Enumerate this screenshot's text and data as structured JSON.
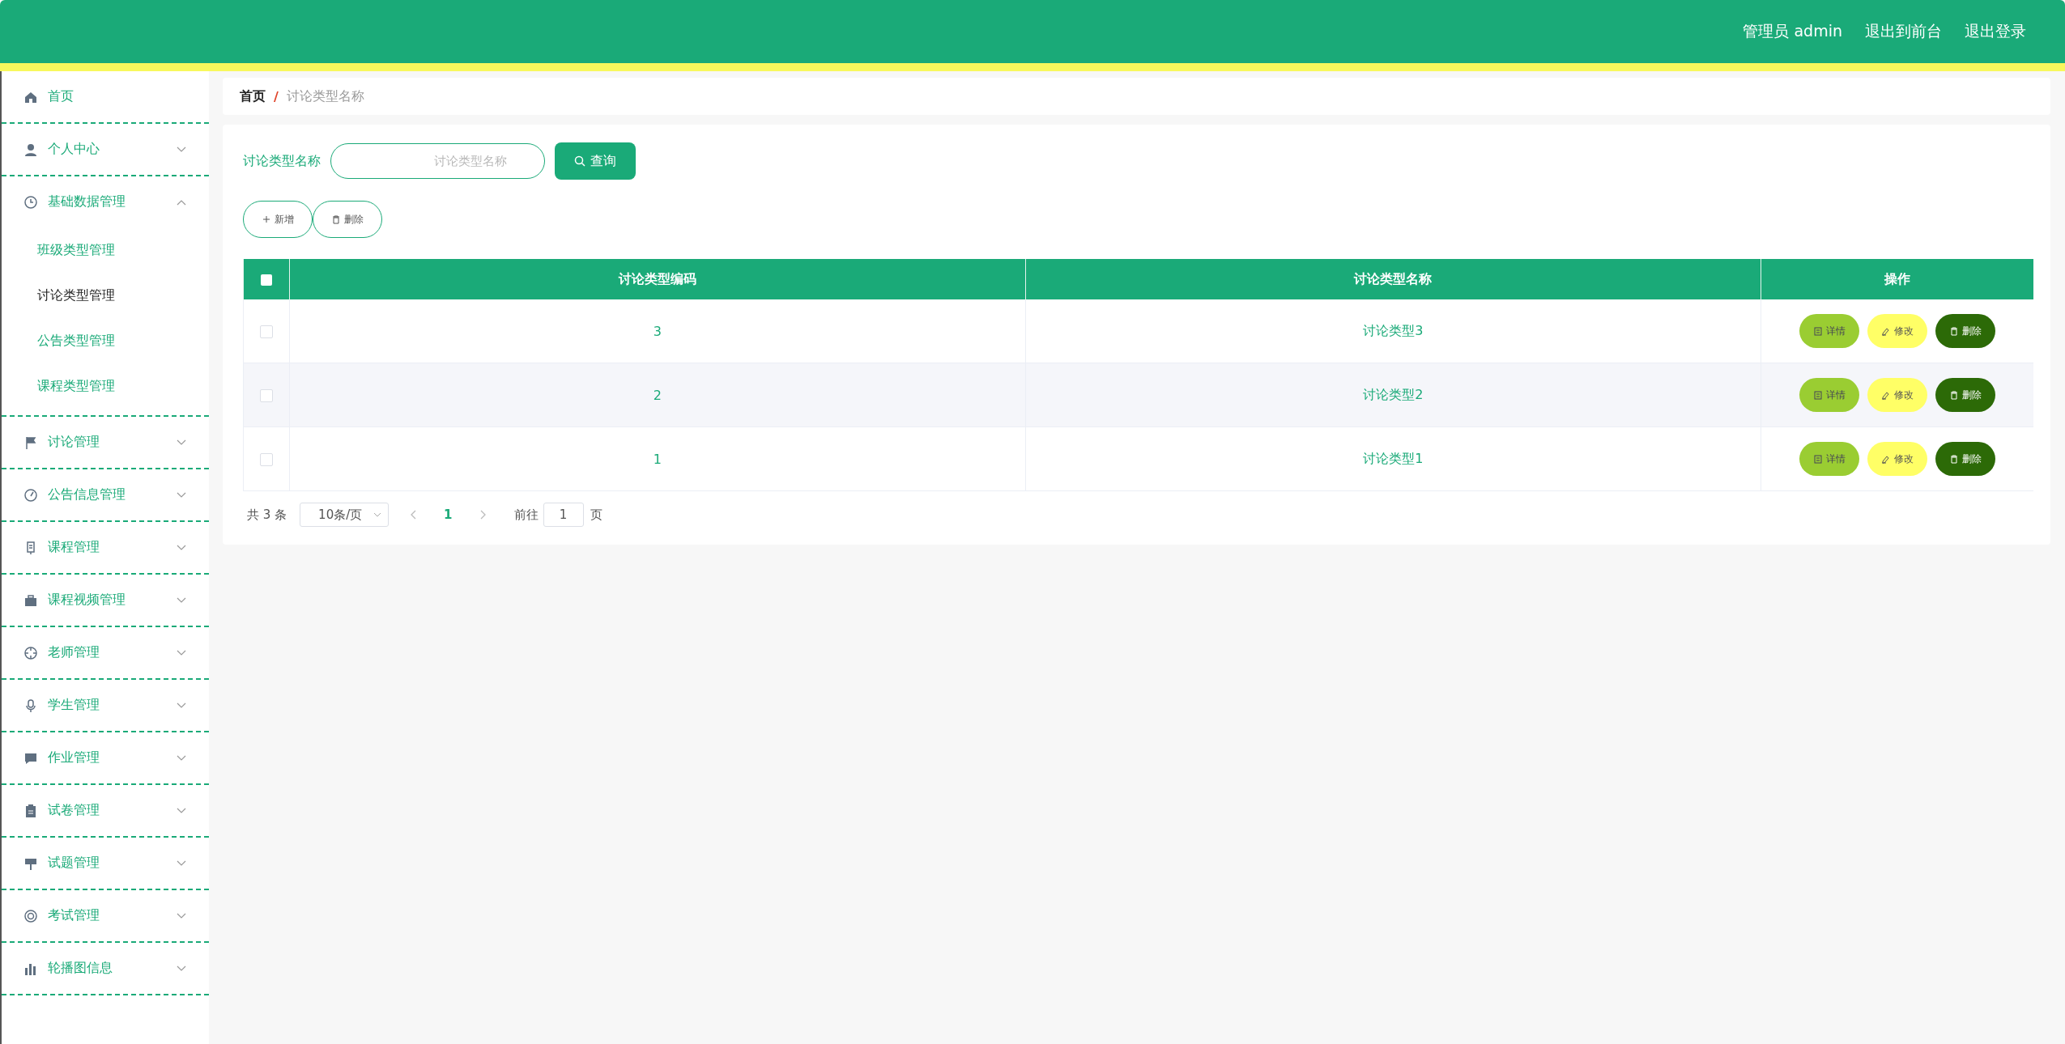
{
  "header": {
    "user_label": "管理员 admin",
    "links": [
      "退出到前台",
      "退出登录"
    ]
  },
  "sidebar": {
    "items": [
      {
        "label": "首页"
      },
      {
        "label": "个人中心",
        "expanded": false
      },
      {
        "label": "基础数据管理",
        "expanded": true,
        "children": [
          {
            "label": "班级类型管理",
            "selected": false
          },
          {
            "label": "讨论类型管理",
            "selected": true
          },
          {
            "label": "公告类型管理",
            "selected": false
          },
          {
            "label": "课程类型管理",
            "selected": false
          }
        ]
      },
      {
        "label": "讨论管理",
        "expanded": false
      },
      {
        "label": "公告信息管理",
        "expanded": false
      },
      {
        "label": "课程管理",
        "expanded": false
      },
      {
        "label": "课程视频管理",
        "expanded": false
      },
      {
        "label": "老师管理",
        "expanded": false
      },
      {
        "label": "学生管理",
        "expanded": false
      },
      {
        "label": "作业管理",
        "expanded": false
      },
      {
        "label": "试卷管理",
        "expanded": false
      },
      {
        "label": "试题管理",
        "expanded": false
      },
      {
        "label": "考试管理",
        "expanded": false
      },
      {
        "label": "轮播图信息",
        "expanded": false
      }
    ]
  },
  "breadcrumb": {
    "items": [
      "首页",
      "讨论类型名称"
    ],
    "separator": "/"
  },
  "search": {
    "label": "讨论类型名称",
    "placeholder": "讨论类型名称",
    "button": "查询"
  },
  "actions": [
    {
      "kind": "add",
      "label": "新增"
    },
    {
      "kind": "delete",
      "label": "删除"
    }
  ],
  "table": {
    "all_checked": false,
    "columns": [
      "讨论类型编码",
      "讨论类型名称",
      "操作"
    ],
    "rows": [
      {
        "checked": false,
        "code": "3",
        "name": "讨论类型3",
        "actions": [
          {
            "kind": "detail",
            "label": "详情"
          },
          {
            "kind": "edit",
            "label": "修改"
          },
          {
            "kind": "delete",
            "label": "删除"
          }
        ]
      },
      {
        "checked": false,
        "code": "2",
        "name": "讨论类型2",
        "actions": [
          {
            "kind": "detail",
            "label": "详情"
          },
          {
            "kind": "edit",
            "label": "修改"
          },
          {
            "kind": "delete",
            "label": "删除"
          }
        ]
      },
      {
        "checked": false,
        "code": "1",
        "name": "讨论类型1",
        "actions": [
          {
            "kind": "detail",
            "label": "详情"
          },
          {
            "kind": "edit",
            "label": "修改"
          },
          {
            "kind": "delete",
            "label": "删除"
          }
        ]
      }
    ]
  },
  "pagination": {
    "total": "共 3 条",
    "page_size": "10条/页",
    "pages": [
      {
        "label": "1",
        "selected": true
      }
    ],
    "goto_label": "前往",
    "goto_value": "1",
    "page_suffix": "页"
  }
}
